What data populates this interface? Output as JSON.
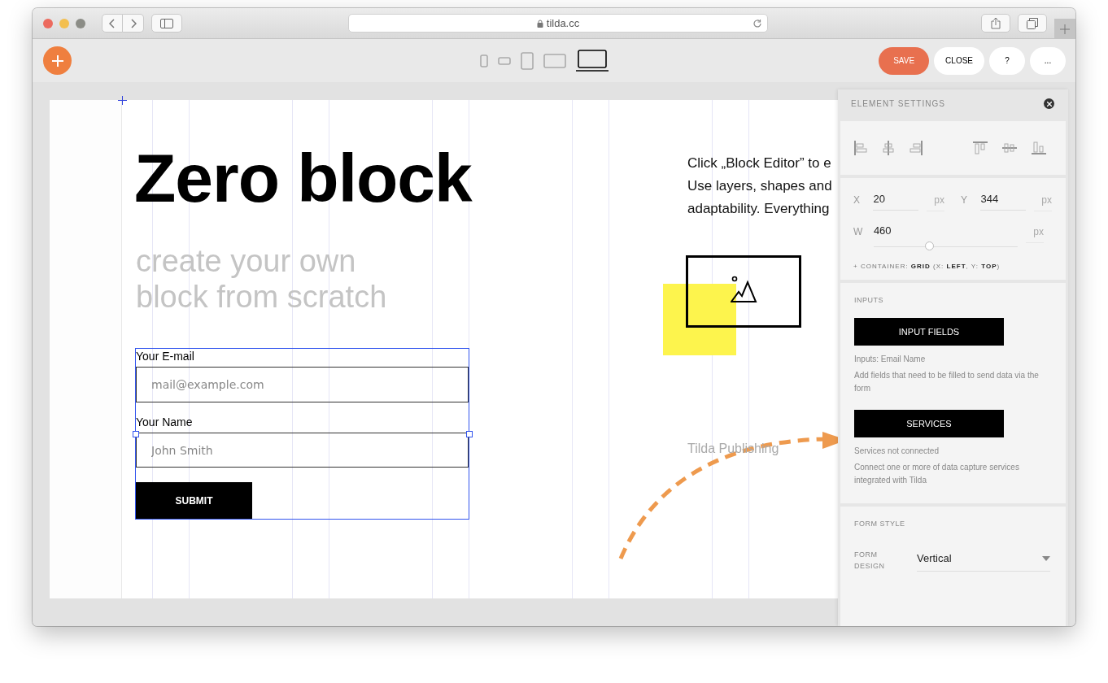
{
  "browser": {
    "url": "tilda.cc"
  },
  "toolbar": {
    "devices": [
      {
        "kind": "phone",
        "selected": false
      },
      {
        "kind": "phone-landscape",
        "selected": false
      },
      {
        "kind": "tablet",
        "selected": false
      },
      {
        "kind": "tablet-landscape",
        "selected": false
      },
      {
        "kind": "laptop",
        "selected": true
      }
    ],
    "actions": [
      {
        "label": "SAVE",
        "kind": "primary"
      },
      {
        "label": "CLOSE",
        "kind": "plain"
      },
      {
        "label": "?",
        "kind": "plain"
      },
      {
        "label": "...",
        "kind": "plain"
      }
    ]
  },
  "canvas": {
    "title": "Zero block",
    "subtitle_lines": [
      "create your own",
      "block from scratch"
    ],
    "paragraph_lines": [
      "Click „Block Editor” to e",
      "Use layers, shapes and",
      "adaptability. Everything"
    ],
    "form": {
      "fields": [
        {
          "label": "Your E-mail",
          "placeholder": "mail@example.com"
        },
        {
          "label": "Your Name",
          "placeholder": "John Smith"
        }
      ],
      "submit": "SUBMIT"
    },
    "caption": "Tilda Publishing"
  },
  "panel": {
    "title": "ELEMENT SETTINGS",
    "position": [
      {
        "label": "X",
        "value": "20",
        "unit": "px"
      },
      {
        "label": "Y",
        "value": "344",
        "unit": "px"
      }
    ],
    "width": {
      "label": "W",
      "value": "460",
      "unit": "px",
      "level": 0.39
    },
    "container_note": "+ CONTAINER: **GRID** (X: **LEFT**, Y: **TOP**)",
    "inputs": {
      "heading": "INPUTS",
      "button": "INPUT FIELDS",
      "status": "Inputs: Email Name",
      "hint": "Add fields that need to be filled to send data via the form"
    },
    "services": {
      "button": "SERVICES",
      "status": "Services not connected",
      "hint": "Connect one or more of data capture services integrated with Tilda"
    },
    "form_style": {
      "heading": "FORM STYLE",
      "fields": [
        {
          "label": "FORM DESIGN",
          "value": "Vertical"
        }
      ]
    }
  }
}
